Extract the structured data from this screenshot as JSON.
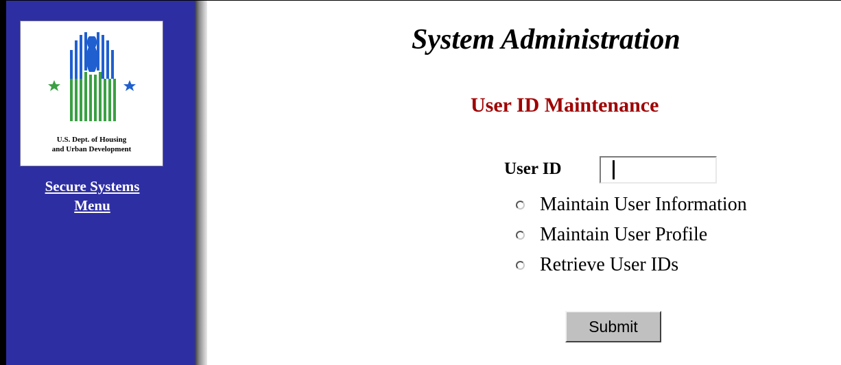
{
  "sidebar": {
    "logo": {
      "icon": "hud-seal-icon",
      "caption_line1": "U.S. Dept. of Housing",
      "caption_line2": "and Urban Development"
    },
    "menu_link_line1": "Secure Systems",
    "menu_link_line2": "Menu"
  },
  "main": {
    "title": "System Administration",
    "section_title": "User ID Maintenance",
    "form": {
      "userid_label": "User ID",
      "userid_value": "",
      "options": [
        {
          "label": "Maintain User Information",
          "selected": false
        },
        {
          "label": "Maintain User Profile",
          "selected": false
        },
        {
          "label": "Retrieve User IDs",
          "selected": false
        }
      ],
      "submit_label": "Submit"
    }
  },
  "colors": {
    "sidebar_bg": "#2e2ea3",
    "section_title": "#a00000",
    "logo_blue": "#1f5fd0",
    "logo_green": "#3aa043"
  }
}
